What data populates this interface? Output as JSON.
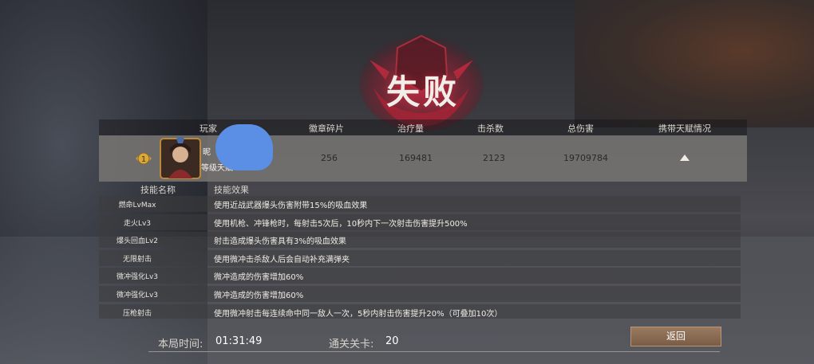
{
  "result_title": "失败",
  "table_header": {
    "player": "玩家",
    "badge_fragments": "徽章碎片",
    "healing": "治疗量",
    "kills": "击杀数",
    "total_damage": "总伤害",
    "talents": "携带天赋情况"
  },
  "player": {
    "rank": "1",
    "name": "昵",
    "level_text": "等级天赋",
    "badge_fragments": "256",
    "healing": "169481",
    "kills": "2123",
    "total_damage": "19709784",
    "avatar_icon": "character-portrait",
    "rank_icon": "rank-wings-badge",
    "expand_icon": "triangle-up-icon"
  },
  "skills_header": {
    "name": "技能名称",
    "effect": "技能效果"
  },
  "skills": [
    {
      "name": "燃命LvMax",
      "effect": "使用近战武器爆头伤害附带15%的吸血效果"
    },
    {
      "name": "走火Lv3",
      "effect": "使用机枪、冲锋枪时，每射击5次后，10秒内下一次射击伤害提升500%"
    },
    {
      "name": "爆头回血Lv2",
      "effect": "射击造成爆头伤害具有3%的吸血效果"
    },
    {
      "name": "无限射击",
      "effect": "使用微冲击杀敌人后会自动补充满弹夹"
    },
    {
      "name": "微冲强化Lv3",
      "effect": "微冲造成的伤害增加60%"
    },
    {
      "name": "微冲强化Lv3",
      "effect": "微冲造成的伤害增加60%"
    },
    {
      "name": "压枪射击",
      "effect": "使用微冲射击每连续命中同一敌人一次，5秒内射击伤害提升20%（可叠加10次）"
    }
  ],
  "footer": {
    "time_label": "本局时间:",
    "time_value": "01:31:49",
    "stage_label": "通关关卡:",
    "stage_value": "20"
  },
  "return_button": "返回",
  "colors": {
    "accent_red": "#c8283c",
    "button": "#8a6a52",
    "blur_mask": "#5b8fe6"
  }
}
